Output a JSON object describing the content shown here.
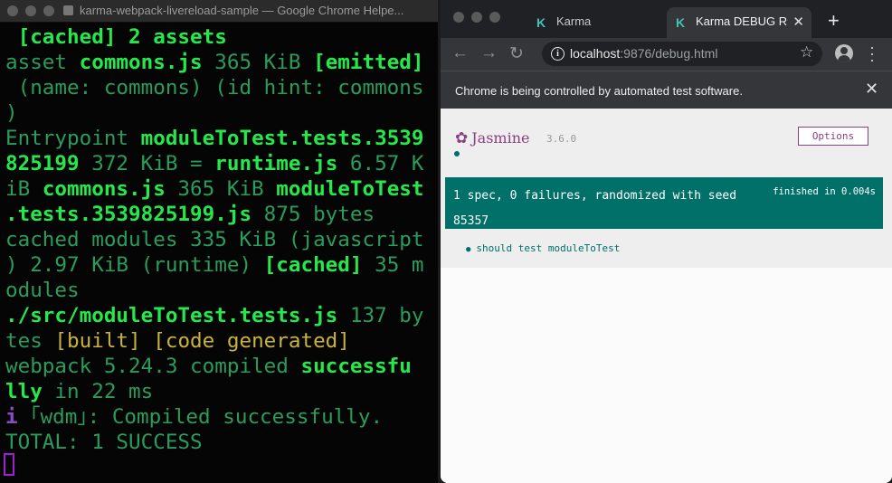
{
  "terminal": {
    "title": "karma-webpack-livereload-sample — Google Chrome Helpe...",
    "lines": [
      [
        {
          "t": " [cached] 2 assets",
          "c": "b"
        }
      ],
      [
        {
          "t": "asset ",
          "c": "g"
        },
        {
          "t": "commons.js",
          "c": "b"
        },
        {
          "t": " 365 KiB ",
          "c": "g"
        },
        {
          "t": "[emitted]",
          "c": "b"
        },
        {
          "t": " (",
          "c": "g"
        }
      ],
      [
        {
          "t": " (name: commons) (id hint: commons",
          "c": "g"
        }
      ],
      [
        {
          "t": ")",
          "c": "g"
        }
      ],
      [
        {
          "t": "Entrypoint ",
          "c": "g"
        },
        {
          "t": "moduleToTest.tests.3539",
          "c": "b"
        }
      ],
      [
        {
          "t": "825199",
          "c": "b"
        },
        {
          "t": " 372 KiB = ",
          "c": "g"
        },
        {
          "t": "runtime.js",
          "c": "b"
        },
        {
          "t": " 6.57 K",
          "c": "g"
        }
      ],
      [
        {
          "t": "iB ",
          "c": "g"
        },
        {
          "t": "commons.js",
          "c": "b"
        },
        {
          "t": " 365 KiB ",
          "c": "g"
        },
        {
          "t": "moduleToTest",
          "c": "b"
        }
      ],
      [
        {
          "t": ".tests.3539825199.js",
          "c": "b"
        },
        {
          "t": " 875 bytes",
          "c": "g"
        }
      ],
      [
        {
          "t": "cached modules 335 KiB (javascript",
          "c": "g"
        }
      ],
      [
        {
          "t": ") 2.97 KiB (runtime) ",
          "c": "g"
        },
        {
          "t": "[cached]",
          "c": "b"
        },
        {
          "t": " 35 m",
          "c": "g"
        }
      ],
      [
        {
          "t": "odules",
          "c": "g"
        }
      ],
      [
        {
          "t": "./src/moduleToTest.tests.js",
          "c": "b"
        },
        {
          "t": " 137 by",
          "c": "g"
        }
      ],
      [
        {
          "t": "tes ",
          "c": "g"
        },
        {
          "t": "[built] [code generated]",
          "c": "y"
        }
      ],
      [
        {
          "t": "webpack 5.24.3 compiled ",
          "c": "g"
        },
        {
          "t": "successfu",
          "c": "b"
        }
      ],
      [
        {
          "t": "lly",
          "c": "b"
        },
        {
          "t": " in 22 ms",
          "c": "g"
        }
      ],
      [
        {
          "t": "i",
          "c": "p"
        },
        {
          "t": " ｢wdm｣: Compiled successfully.",
          "c": "g"
        }
      ],
      [
        {
          "t": "TOTAL: 1 SUCCESS",
          "c": "g"
        }
      ]
    ]
  },
  "browser": {
    "tabs": [
      {
        "label": "Karma",
        "icon": "karma-logo-icon"
      },
      {
        "label": "Karma DEBUG R",
        "icon": "karma-logo-icon",
        "active": true
      }
    ],
    "url_host": "localhost",
    "url_path": ":9876/debug.html",
    "infobar_text": "Chrome is being controlled by automated test software."
  },
  "jasmine": {
    "logo_text": "Jasmine",
    "version": "3.6.0",
    "options_label": "Options",
    "summary": "1 spec, 0 failures, randomized with seed 85357",
    "duration": "finished in 0.004s",
    "specs": [
      "should test moduleToTest"
    ]
  },
  "colors": {
    "terminal_green": "#2a9c5c",
    "terminal_bright_green": "#27e84a",
    "terminal_yellow": "#c8b43a",
    "jasmine_teal": "#007069",
    "jasmine_purple": "#8a4182"
  }
}
